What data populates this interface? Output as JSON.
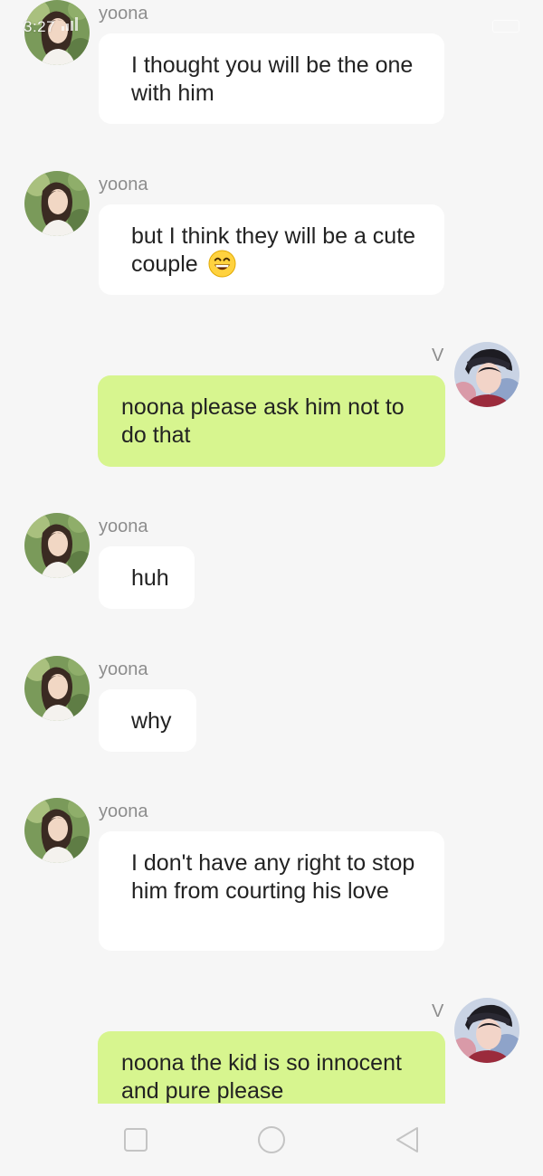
{
  "status_bar": {
    "time": "3:27"
  },
  "contacts": {
    "incoming": {
      "name": "yoona",
      "avatar": "yoona-avatar"
    },
    "outgoing": {
      "name": "V",
      "avatar": "v-avatar"
    }
  },
  "messages": [
    {
      "sender": "yoona",
      "text": "I thought you will be the one with him"
    },
    {
      "sender": "yoona",
      "text": "but I think they will be a cute couple",
      "emoji": "grinning-face"
    },
    {
      "sender": "V",
      "text": "noona please ask him not to do that"
    },
    {
      "sender": "yoona",
      "text": "huh"
    },
    {
      "sender": "yoona",
      "text": "why"
    },
    {
      "sender": "yoona",
      "text": "I don't have any right to stop him from courting his love"
    },
    {
      "sender": "V",
      "text": "noona the kid is so innocent and pure please"
    }
  ],
  "colors": {
    "background": "#f6f6f6",
    "incoming_bubble": "#ffffff",
    "outgoing_bubble": "#d7f58f",
    "sender_name": "#8d8d8d"
  },
  "navigation": {
    "recent_apps_icon": "square-icon",
    "home_icon": "circle-icon",
    "back_icon": "triangle-back-icon"
  }
}
